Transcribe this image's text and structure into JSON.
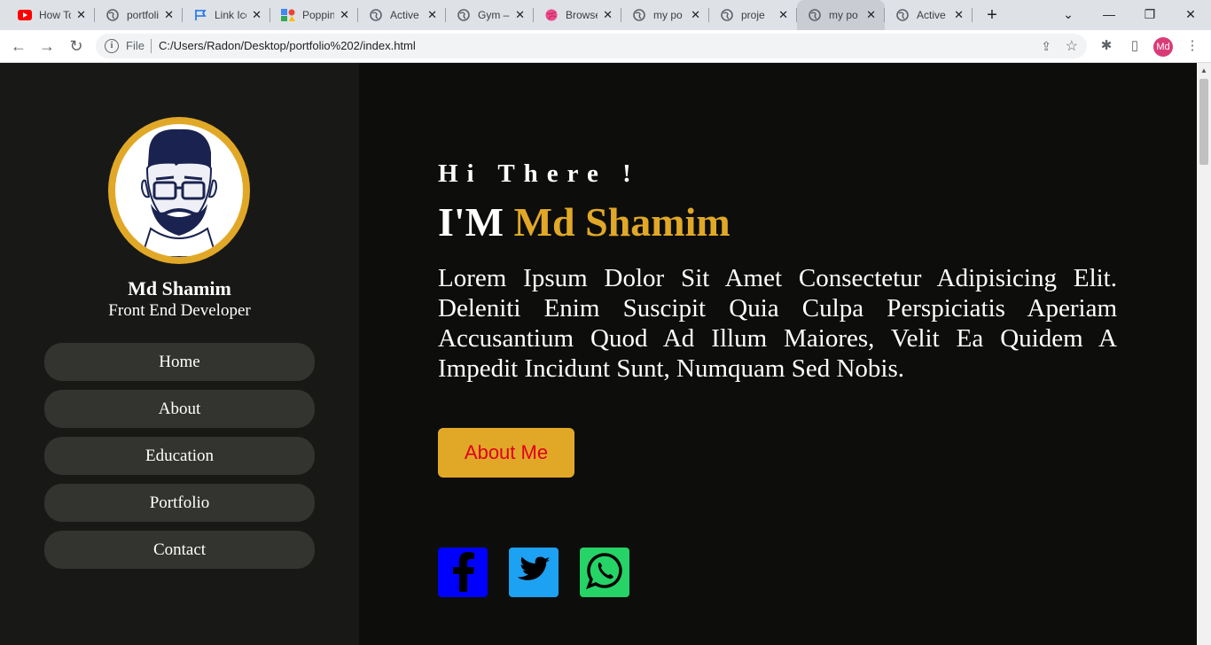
{
  "browser": {
    "tabs": [
      {
        "title": "How To Make",
        "icon": "youtube-icon"
      },
      {
        "title": "portfolio",
        "icon": "globe-icon"
      },
      {
        "title": "Link Icon",
        "icon": "flag-icon"
      },
      {
        "title": "Poppins",
        "icon": "google-fonts-icon"
      },
      {
        "title": "Active",
        "icon": "globe-icon"
      },
      {
        "title": "Gym – ",
        "icon": "globe-icon"
      },
      {
        "title": "Browse",
        "icon": "dribbble-icon"
      },
      {
        "title": "my po",
        "icon": "globe-icon"
      },
      {
        "title": "proje",
        "icon": "globe-icon"
      },
      {
        "title": "my po",
        "icon": "globe-icon"
      },
      {
        "title": "Active",
        "icon": "globe-icon"
      }
    ],
    "scheme_label": "File",
    "url": "C:/Users/Radon/Desktop/portfolio%202/index.html",
    "profile_initials": "Md"
  },
  "sidebar": {
    "name": "Md Shamim",
    "role": "Front End Developer",
    "nav": [
      {
        "label": "Home"
      },
      {
        "label": "About"
      },
      {
        "label": "Education"
      },
      {
        "label": "Portfolio"
      },
      {
        "label": "Contact"
      }
    ]
  },
  "hero": {
    "greeting": "Hi There !",
    "intro_prefix": "I'M ",
    "intro_name": "Md Shamim",
    "description": "Lorem Ipsum Dolor Sit Amet Consectetur Adipisicing Elit. Deleniti Enim Suscipit Quia Culpa Perspiciatis Aperiam Accusantium Quod Ad Illum Maiores, Velit Ea Quidem A Impedit Incidunt Sunt, Numquam Sed Nobis.",
    "cta_label": "About Me"
  },
  "social": [
    {
      "icon": "facebook-icon",
      "color": "#0000ff"
    },
    {
      "icon": "twitter-icon",
      "color": "#1da1f2"
    },
    {
      "icon": "whatsapp-icon",
      "color": "#25d366"
    }
  ],
  "colors": {
    "accent": "#e1a828",
    "sidebar_bg": "#181916",
    "main_bg": "#0d0e0b",
    "nav_item_bg": "#33332f",
    "cta_text": "#e0001a"
  }
}
